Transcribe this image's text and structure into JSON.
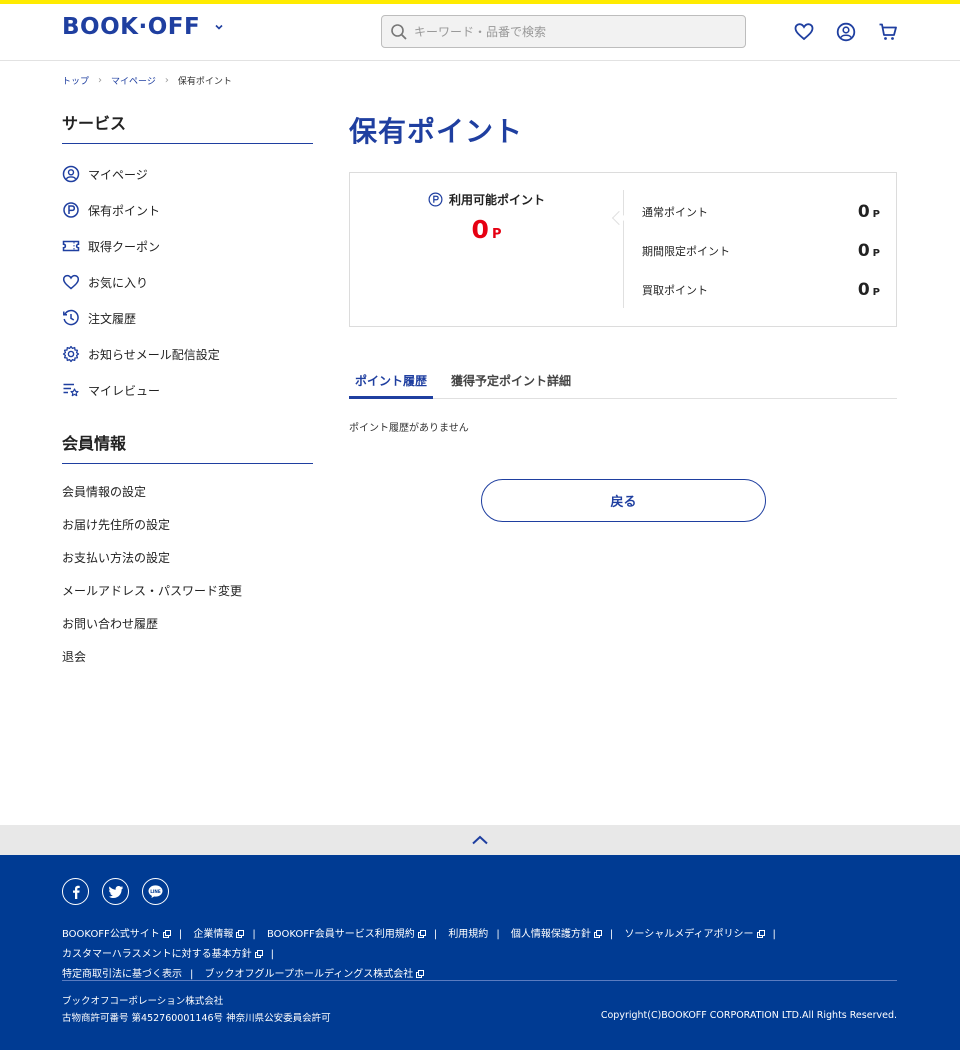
{
  "header": {
    "logo": "BOOK·OFF",
    "search_placeholder": "キーワード・品番で検索"
  },
  "breadcrumb": {
    "items": [
      "トップ",
      "マイページ",
      "保有ポイント"
    ]
  },
  "sidebar": {
    "service_heading": "サービス",
    "service_items": [
      {
        "label": "マイページ",
        "icon": "user-circle-icon"
      },
      {
        "label": "保有ポイント",
        "icon": "point-icon"
      },
      {
        "label": "取得クーポン",
        "icon": "coupon-icon"
      },
      {
        "label": "お気に入り",
        "icon": "heart-icon"
      },
      {
        "label": "注文履歴",
        "icon": "history-icon"
      },
      {
        "label": "お知らせメール配信設定",
        "icon": "gear-icon"
      },
      {
        "label": "マイレビュー",
        "icon": "review-icon"
      }
    ],
    "member_heading": "会員情報",
    "member_items": [
      "会員情報の設定",
      "お届け先住所の設定",
      "お支払い方法の設定",
      "メールアドレス・パスワード変更",
      "お問い合わせ履歴",
      "退会"
    ]
  },
  "main": {
    "title": "保有ポイント",
    "available_label": "利用可能ポイント",
    "available_value": "0",
    "point_unit": "P",
    "breakdown": [
      {
        "label": "通常ポイント",
        "value": "0"
      },
      {
        "label": "期間限定ポイント",
        "value": "0"
      },
      {
        "label": "買取ポイント",
        "value": "0"
      }
    ],
    "tabs": [
      "ポイント履歴",
      "獲得予定ポイント詳細"
    ],
    "empty_message": "ポイント履歴がありません",
    "back_button": "戻る"
  },
  "footer": {
    "links": [
      "BOOKOFF公式サイト",
      "企業情報",
      "BOOKOFF会員サービス利用規約",
      "利用規約",
      "個人情報保護方針",
      "ソーシャルメディアポリシー",
      "カスタマーハラスメントに対する基本方針",
      "特定商取引法に基づく表示",
      "ブックオフグループホールディングス株式会社"
    ],
    "company": "ブックオフコーポレーション株式会社",
    "license": "古物商許可番号 第452760001146号 神奈川県公安委員会許可",
    "copyright": "Copyright(C)BOOKOFF CORPORATION LTD.All Rights Reserved."
  },
  "colors": {
    "brand_blue": "#1f3fa0",
    "footer_blue": "#003b93",
    "accent_yellow": "#ffeb00",
    "point_red": "#e60012"
  }
}
